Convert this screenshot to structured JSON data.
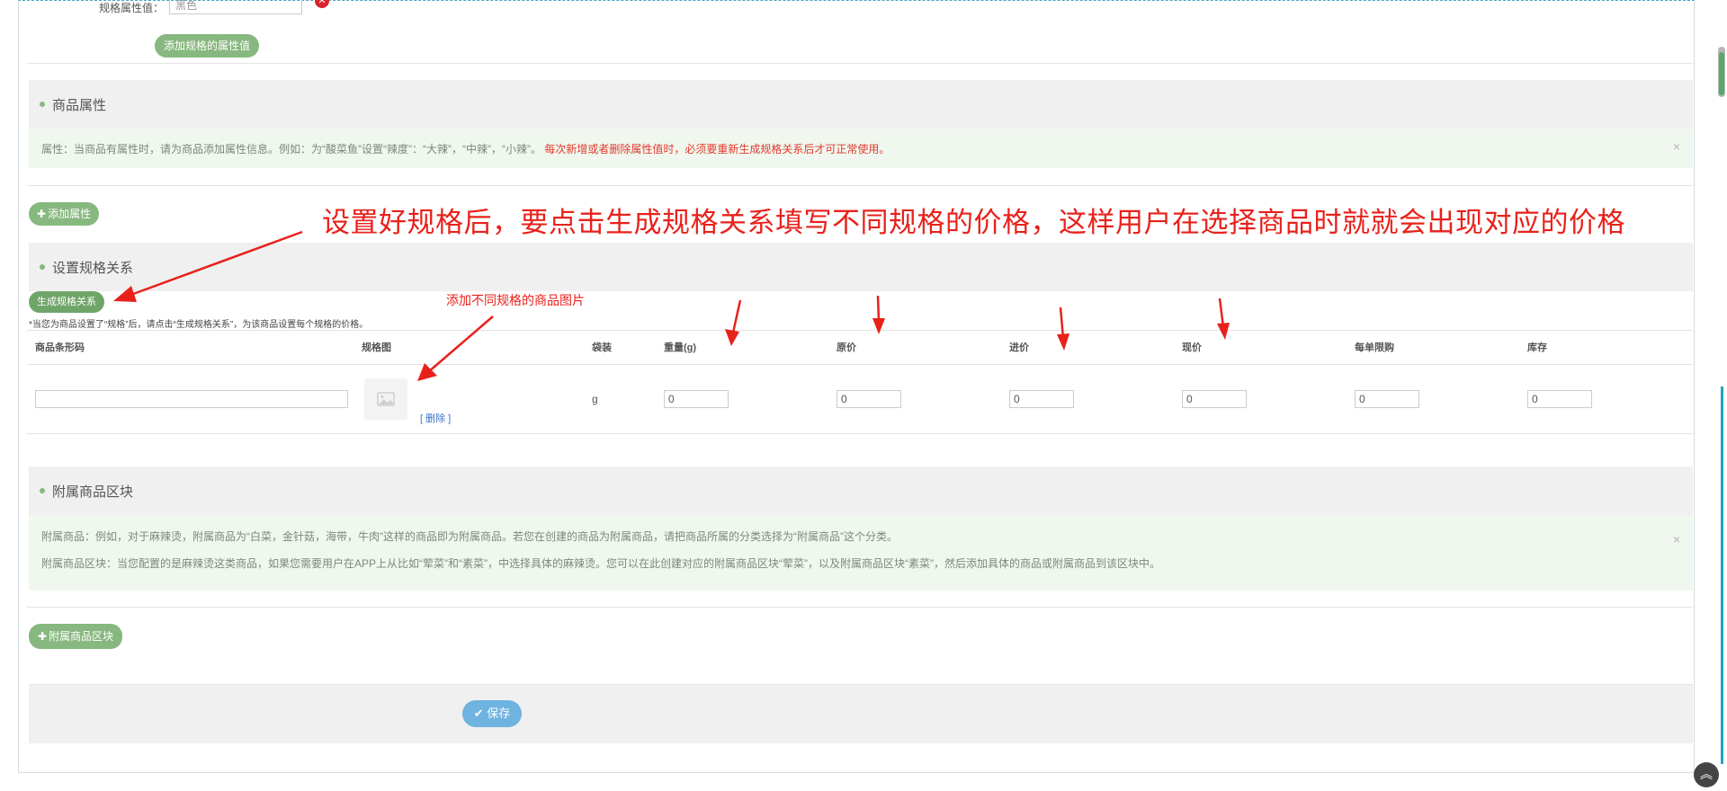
{
  "spec": {
    "attr_value_label": "规格属性值：",
    "attr_value_input": "黑色",
    "add_attr_value_button": "添加规格的属性值"
  },
  "attributes": {
    "title": "商品属性",
    "note_text": "属性：当商品有属性时，请为商品添加属性信息。例如：为“酸菜鱼”设置“辣度”：“大辣”，“中辣”，“小辣”。",
    "note_warning": "每次新增或者删除属性值时，必须要重新生成规格关系后才可正常使用。",
    "close_symbol": "×",
    "add_button": "添加属性"
  },
  "spec_relation": {
    "title": "设置规格关系",
    "generate_button": "生成规格关系",
    "tip": "*当您为商品设置了“规格”后，请点击“生成规格关系”，为该商品设置每个规格的价格。",
    "columns": [
      "商品条形码",
      "规格图",
      "袋装",
      "重量(g)",
      "原价",
      "进价",
      "现价",
      "每单限购",
      "库存"
    ],
    "row": {
      "barcode": "",
      "delete_link": "[ 删除 ]",
      "unit": "g",
      "weight": "0",
      "original_price": "0",
      "purchase_price": "0",
      "current_price": "0",
      "limit_per_order": "0",
      "stock": "0"
    }
  },
  "accessory": {
    "title": "附属商品区块",
    "note_line1": "附属商品：例如，对于麻辣烫，附属商品为“白菜，金针菇，海带，牛肉”这样的商品即为附属商品。若您在创建的商品为附属商品，请把商品所属的分类选择为“附属商品”这个分类。",
    "note_line2": "附属商品区块：当您配置的是麻辣烫这类商品，如果您需要用户在APP上从比如“荤菜”和“素菜”，中选择具体的麻辣烫。您可以在此创建对应的附属商品区块“荤菜”，以及附属商品区块“素菜”，然后添加具体的商品或附属商品到该区块中。",
    "close_symbol": "×",
    "add_button": "附属商品区块"
  },
  "save_button": "保存",
  "annotations": {
    "main": "设置好规格后，要点击生成规格关系填写不同规格的价格，这样用户在选择商品时就就会出现对应的价格",
    "image": "添加不同规格的商品图片"
  },
  "colors": {
    "green_button": "#87b87f",
    "blue_button": "#6fb3e0",
    "annotation_red": "#e8211b",
    "section_bg": "#f0f0f0",
    "note_bg": "#f0f7ee"
  }
}
